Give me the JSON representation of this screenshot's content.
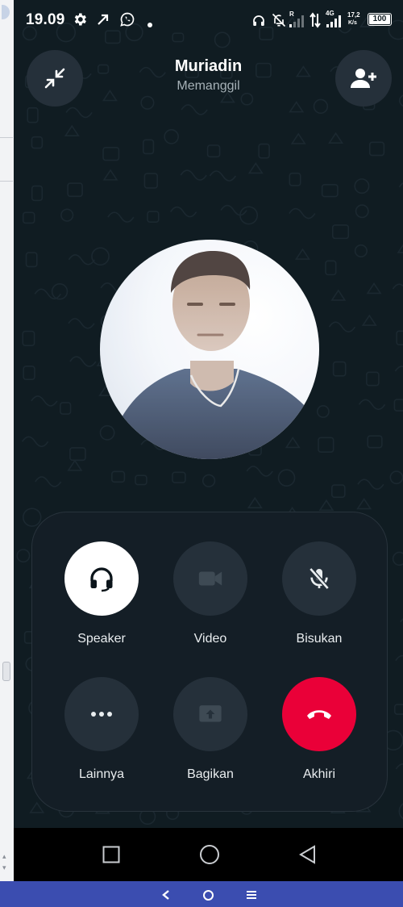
{
  "status_bar": {
    "time": "19.09",
    "left_icons": [
      "gear-icon",
      "arrow-up-right-icon",
      "whatsapp-icon",
      "dot-icon"
    ],
    "right_icons": [
      "headset-icon",
      "bell-off-icon",
      "signal-icon",
      "data-arrows-icon",
      "signal-4g-icon"
    ],
    "roaming": "R",
    "network_type": "4G",
    "net_speed_value": "17,2",
    "net_speed_unit": "K/s",
    "battery": "100"
  },
  "header": {
    "name": "Muriadin",
    "status": "Memanggil",
    "left_button_icon": "minimize-icon",
    "right_button_icon": "add-person-icon"
  },
  "controls": [
    {
      "label": "Speaker",
      "icon": "headset-icon",
      "active": true
    },
    {
      "label": "Video",
      "icon": "video-camera-icon",
      "active": false
    },
    {
      "label": "Bisukan",
      "icon": "mic-off-icon",
      "active": false
    },
    {
      "label": "Lainnya",
      "icon": "more-dots-icon",
      "active": false
    },
    {
      "label": "Bagikan",
      "icon": "share-screen-icon",
      "active": false
    },
    {
      "label": "Akhiri",
      "icon": "end-call-icon",
      "active": true
    }
  ],
  "nav": {
    "buttons": [
      "recents-square-icon",
      "home-circle-icon",
      "back-triangle-icon"
    ]
  },
  "system_bar": {
    "buttons": [
      "chevron-left-icon",
      "home-ring-icon",
      "menu-lines-icon"
    ]
  },
  "colors": {
    "background": "#101c22",
    "panel": "#141e26",
    "button": "#25303a",
    "end_call": "#ea0038",
    "system_bar": "#3b4db0"
  }
}
